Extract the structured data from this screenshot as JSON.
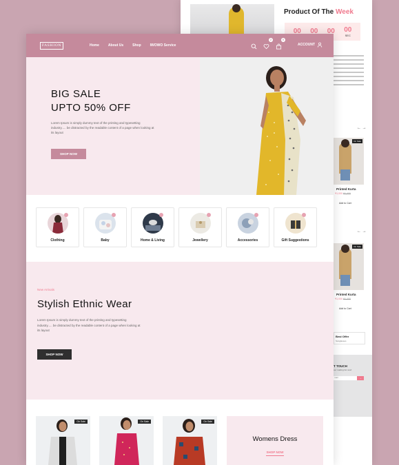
{
  "colors": {
    "background": "#c9a5b1",
    "nav": "#c58a9c",
    "hero_bg": "#f8e9ee",
    "accent": "#f07a8e",
    "dark_button": "#2f2f2f"
  },
  "back_page": {
    "section_title": "Product Of The",
    "section_title_accent": "Week",
    "countdown": [
      {
        "value": "00",
        "label": ""
      },
      {
        "value": "00",
        "label": ""
      },
      {
        "value": "00",
        "label": ""
      },
      {
        "value": "00",
        "label": "SEC"
      }
    ],
    "products": [
      {
        "tag": "On Sale",
        "name": "Printed Kurta",
        "price": "₹1,000",
        "old_price": "₹1,400",
        "cart": "Add to Cart"
      },
      {
        "tag": "On Sale",
        "name": "Printed Kurta",
        "price": "₹1,000",
        "old_price": "₹1,400",
        "cart": "Add to Cart"
      }
    ],
    "best_offer_title": "Best Offer",
    "best_offer_sub": "Sunglasses",
    "touch_title": "T TOUCH",
    "touch_sub": "our mailing list now!",
    "touch_placeholder": "mail",
    "touch_button": "→",
    "arrows": "← →"
  },
  "nav": {
    "logo": "FASHION",
    "links": [
      "Home",
      "About Us",
      "Shop",
      "IWOWO Service"
    ],
    "wishlist_count": "2",
    "cart_count": "0",
    "account_label": "ACCOUNT"
  },
  "hero": {
    "title_line1": "BIG SALE",
    "title_line2": "UPTO 50% OFF",
    "text": "Lorem Ipsum is simply dummy text of the printing and typesetting industry..... be distracted by the readable content of a page when looking at its layout",
    "button": "SHOP NOW"
  },
  "categories": [
    {
      "label": "Clothing",
      "icon": "clothing-icon"
    },
    {
      "label": "Baby",
      "icon": "baby-icon"
    },
    {
      "label": "Home & Living",
      "icon": "home-living-icon"
    },
    {
      "label": "Jewellery",
      "icon": "jewellery-icon"
    },
    {
      "label": "Accessories",
      "icon": "accessories-icon"
    },
    {
      "label": "Gift Suggestions",
      "icon": "gift-icon"
    }
  ],
  "ethnic": {
    "eyebrow": "New Arrivals",
    "title": "Stylish Ethnic Wear",
    "text": "Lorem Ipsum is simply dummy text of the printing and typesetting industry..... be distracted by the readable content of a page when looking at its layout",
    "button": "SHOP NOW"
  },
  "product_tags": [
    "On Sale",
    "On Sale",
    "On Sale"
  ],
  "womens": {
    "title": "Womens Dress",
    "link": "SHOP NOW"
  }
}
